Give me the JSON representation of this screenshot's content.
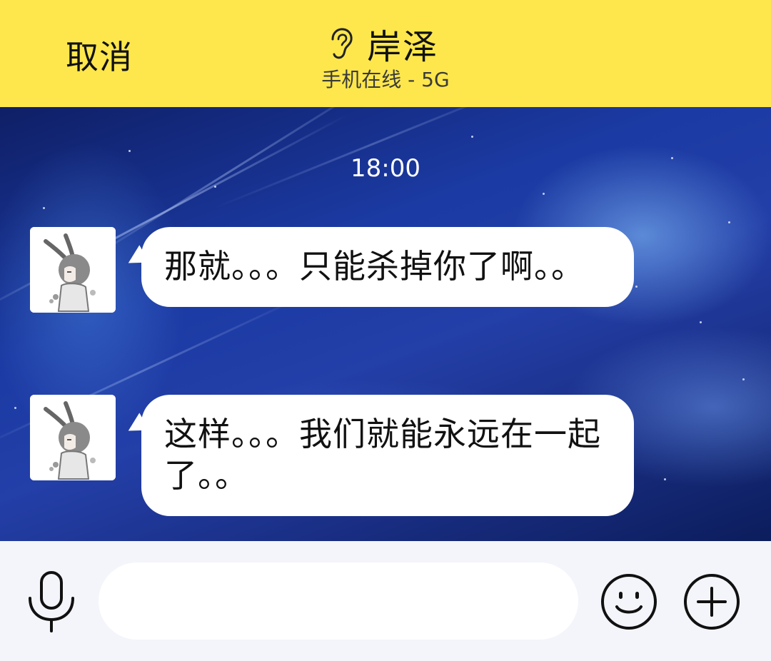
{
  "header": {
    "cancel_label": "取消",
    "contact_name": "岸泽",
    "status_text": "手机在线 - 5G",
    "background_color": "#fde74c",
    "mode_icon": "ear-icon"
  },
  "chat": {
    "timestamp": "18:00",
    "messages": [
      {
        "sender": "contact",
        "avatar": "avatar",
        "text": "那就。。。只能杀掉你了啊。。"
      },
      {
        "sender": "contact",
        "avatar": "avatar",
        "text": "这样。。。我们就能永远在一起了。。"
      }
    ]
  },
  "input_bar": {
    "voice_icon": "microphone-icon",
    "message_input_value": "",
    "emoji_icon": "smiley-icon",
    "more_icon": "plus-icon"
  }
}
